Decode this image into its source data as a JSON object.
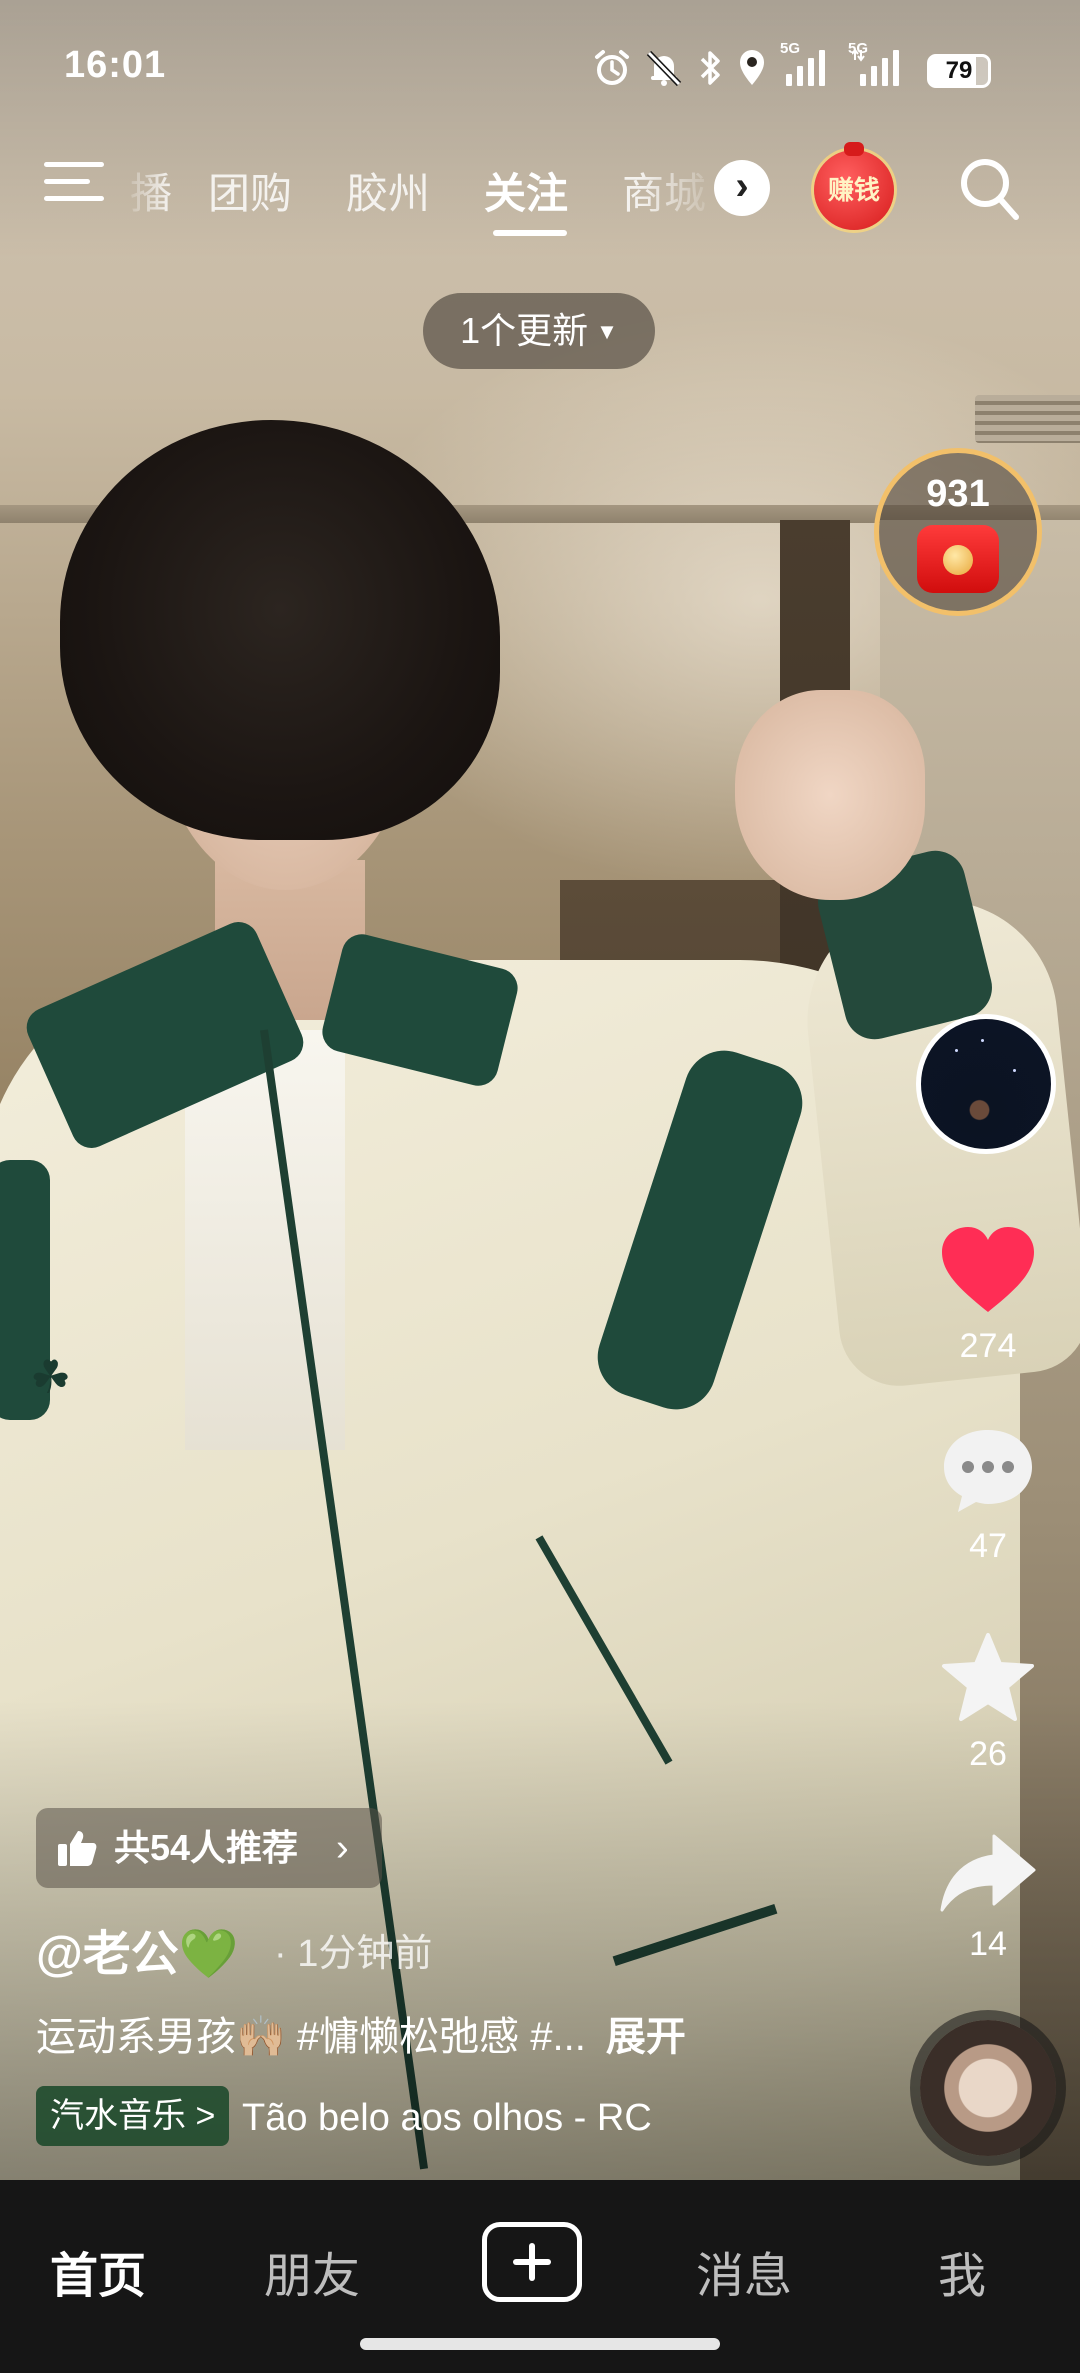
{
  "status_bar": {
    "time": "16:01",
    "battery": "79",
    "network_1": "5G",
    "network_2": "5G"
  },
  "top_nav": {
    "tabs": [
      {
        "label": "播"
      },
      {
        "label": "团购"
      },
      {
        "label": "胶州"
      },
      {
        "label": "关注",
        "active": true
      },
      {
        "label": "商城"
      }
    ],
    "more_icon": "chevron-right-icon",
    "earn_label": "赚钱",
    "search_icon": "search-icon"
  },
  "update_pill": {
    "label": "1个更新"
  },
  "right_rail": {
    "coin_count": "931",
    "likes": "274",
    "comments": "47",
    "favorites": "26",
    "shares": "14"
  },
  "video_info": {
    "recommend": "共54人推荐",
    "author": "@老公💚",
    "time_ago": "· 1分钟前",
    "caption": "运动系男孩🙌🏼 #慵懒松弛感 #...",
    "expand": "展开",
    "music_tag": "汽水音乐 >",
    "song": "Tão belo aos olhos - RC"
  },
  "bottom_nav": {
    "items": [
      {
        "label": "首页",
        "active": true
      },
      {
        "label": "朋友"
      },
      {
        "label": "消息"
      },
      {
        "label": "我"
      }
    ]
  },
  "colors": {
    "like": "#ff2d55",
    "accent_gold": "#f2c06a",
    "music_tag_bg": "#184628"
  }
}
